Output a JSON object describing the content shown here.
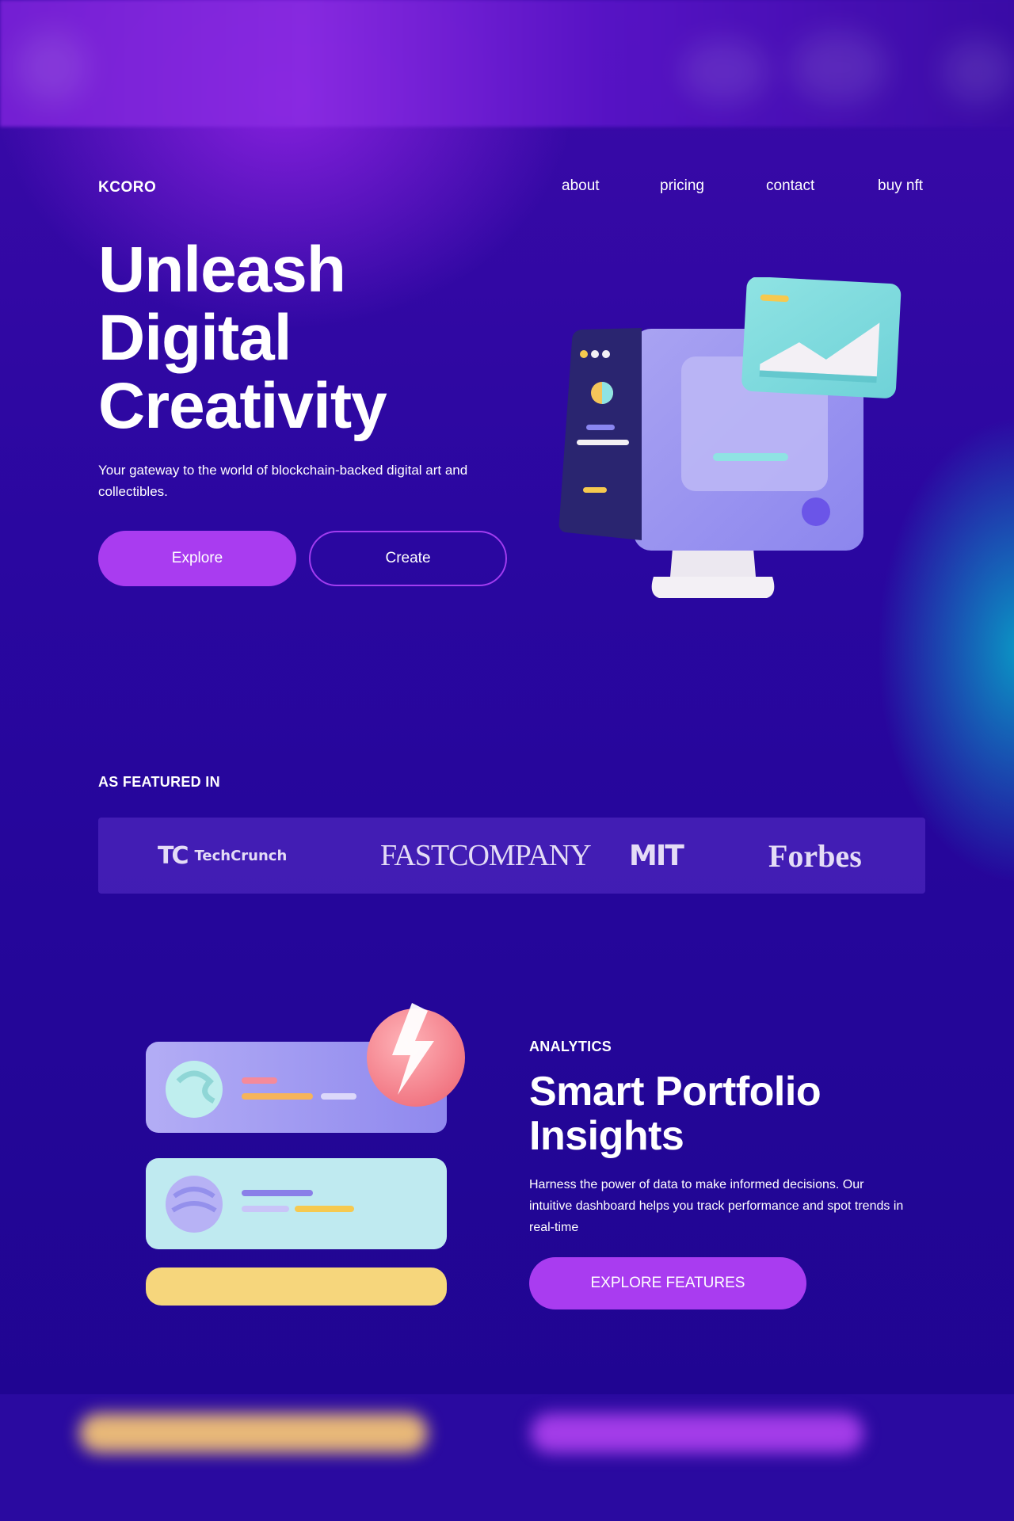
{
  "colors": {
    "background": "#2a07a0",
    "accent": "#a93cf0",
    "teal_glow": "#00c8d2",
    "text": "#ffffff"
  },
  "nav": {
    "logo": "KCORO",
    "links": [
      "about",
      "pricing",
      "contact",
      "buy nft"
    ]
  },
  "hero": {
    "title_lines": [
      "Unleash",
      "Digital",
      "Creativity"
    ],
    "subtitle": "Your gateway to the world of blockchain-backed digital art and collectibles.",
    "primary_button": "Explore",
    "secondary_button": "Create",
    "illustration_icon": "monitor-illustration-icon"
  },
  "featured": {
    "label": "AS FEATURED IN",
    "logos": {
      "techcrunch_mark": "TC",
      "techcrunch": "TechCrunch",
      "fastcompany": "FASTCOMPANY",
      "mit": "MIT",
      "forbes": "Forbes"
    }
  },
  "analytics": {
    "label": "ANALYTICS",
    "title_lines": [
      "Smart Portfolio",
      "Insights"
    ],
    "description": "Harness the power of data to make informed decisions. Our intuitive dashboard helps you track performance and spot trends in real-time",
    "button": "EXPLORE FEATURES",
    "illustration_icon": "portfolio-cards-illustration-icon"
  }
}
